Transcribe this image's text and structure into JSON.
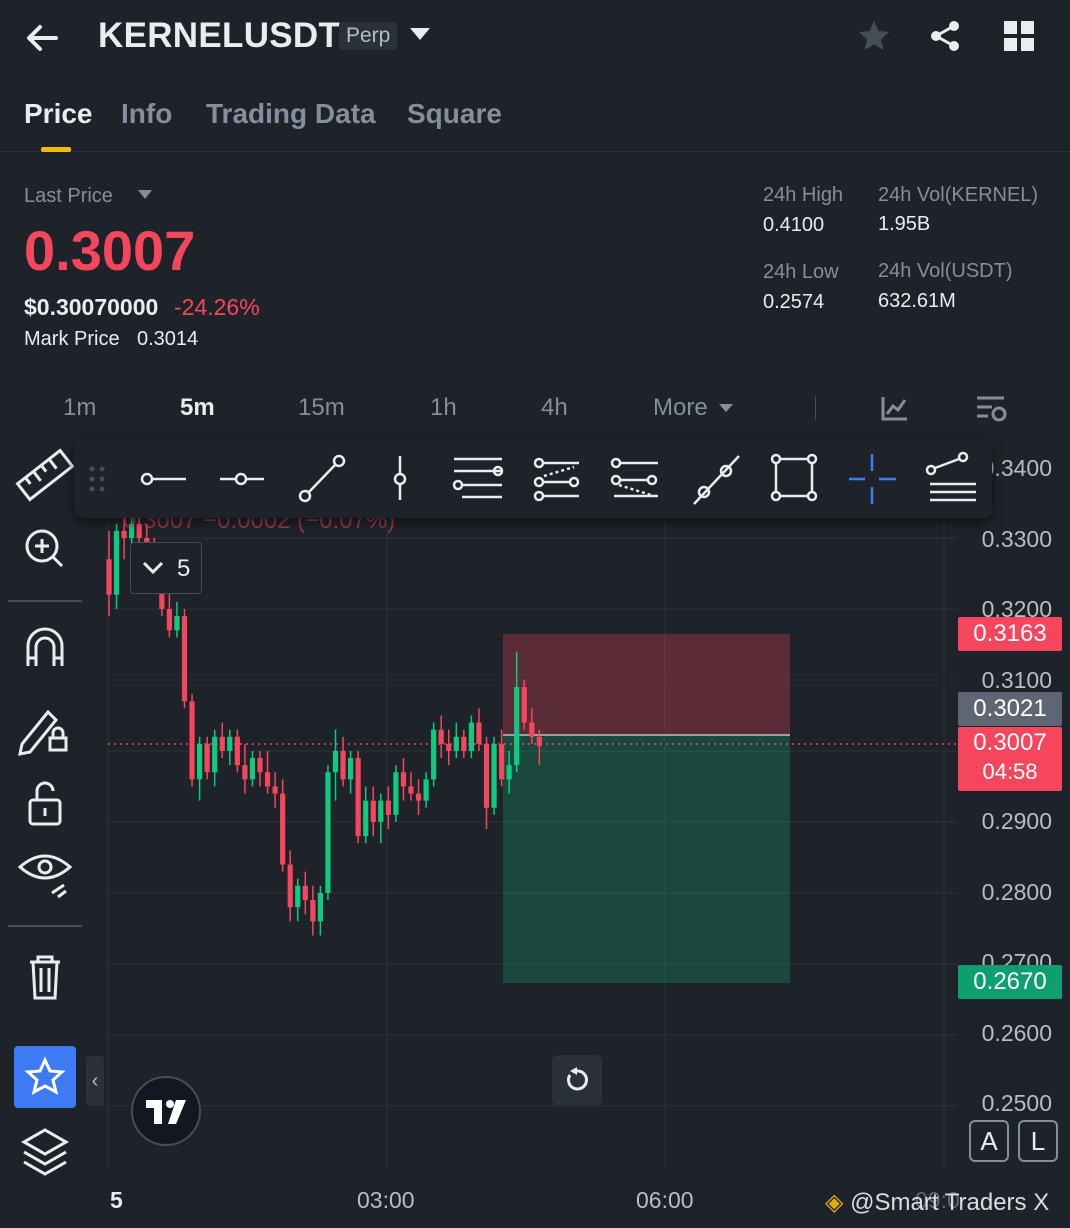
{
  "header": {
    "symbol": "KERNELUSDT",
    "badge": "Perp",
    "icons": [
      "back-arrow-icon",
      "star-icon",
      "share-icon",
      "grid-icon"
    ]
  },
  "tabs": [
    "Price",
    "Info",
    "Trading Data",
    "Square"
  ],
  "active_tab": "Price",
  "price_panel": {
    "last_price_label": "Last Price",
    "last_price": "0.3007",
    "usd_price": "$0.30070000",
    "change": "-24.26%",
    "mark_label": "Mark Price",
    "mark_value": "0.3014",
    "high_label": "24h High",
    "high_value": "0.4100",
    "low_label": "24h Low",
    "low_value": "0.2574",
    "vol_base_label": "24h Vol(KERNEL)",
    "vol_base_value": "1.95B",
    "vol_quote_label": "24h Vol(USDT)",
    "vol_quote_value": "632.61M"
  },
  "timeframes": [
    "1m",
    "5m",
    "15m",
    "1h",
    "4h",
    "More"
  ],
  "active_timeframe": "5m",
  "chart": {
    "legend_faded": "0.3007  −0.0002 (−0.07%)",
    "interval_badge": "5",
    "y_ticks": [
      "0.3400",
      "0.3300",
      "0.3200",
      "0.3100",
      "0.2900",
      "0.2800",
      "0.2700",
      "0.2600",
      "0.2500"
    ],
    "x_ticks": [
      "5",
      "03:00",
      "06:00",
      "09:0"
    ],
    "tags": {
      "stop": "0.3163",
      "mark": "0.3021",
      "last": "0.3007",
      "countdown": "04:58",
      "target": "0.2670"
    },
    "watermark": "@Smart Traders X",
    "scale_buttons": [
      "A",
      "L"
    ],
    "colors": {
      "up": "#0ecb81",
      "down": "#f6465d",
      "accent": "#f0b90b",
      "tool_active": "#3d7bf5"
    }
  },
  "chart_data": {
    "type": "candlestick",
    "interval": "5m",
    "ylim": [
      0.25,
      0.343
    ],
    "position": {
      "entry": 0.3021,
      "stop_loss": 0.3163,
      "take_profit": 0.267
    },
    "last_price": 0.3007,
    "candles": [
      [
        0.327,
        0.331,
        0.319,
        0.322
      ],
      [
        0.322,
        0.332,
        0.32,
        0.331
      ],
      [
        0.331,
        0.334,
        0.327,
        0.33
      ],
      [
        0.33,
        0.334,
        0.329,
        0.332
      ],
      [
        0.332,
        0.333,
        0.329,
        0.33
      ],
      [
        0.33,
        0.332,
        0.328,
        0.329
      ],
      [
        0.329,
        0.33,
        0.325,
        0.327
      ],
      [
        0.327,
        0.328,
        0.319,
        0.32
      ],
      [
        0.32,
        0.324,
        0.316,
        0.317
      ],
      [
        0.317,
        0.321,
        0.316,
        0.319
      ],
      [
        0.319,
        0.32,
        0.306,
        0.307
      ],
      [
        0.307,
        0.308,
        0.295,
        0.296
      ],
      [
        0.296,
        0.302,
        0.293,
        0.301
      ],
      [
        0.301,
        0.302,
        0.296,
        0.297
      ],
      [
        0.297,
        0.303,
        0.295,
        0.302
      ],
      [
        0.302,
        0.304,
        0.299,
        0.3
      ],
      [
        0.3,
        0.303,
        0.298,
        0.302
      ],
      [
        0.302,
        0.303,
        0.297,
        0.298
      ],
      [
        0.298,
        0.301,
        0.294,
        0.296
      ],
      [
        0.296,
        0.3,
        0.295,
        0.299
      ],
      [
        0.299,
        0.3,
        0.295,
        0.297
      ],
      [
        0.297,
        0.3,
        0.294,
        0.295
      ],
      [
        0.295,
        0.297,
        0.292,
        0.294
      ],
      [
        0.294,
        0.296,
        0.283,
        0.284
      ],
      [
        0.284,
        0.286,
        0.276,
        0.278
      ],
      [
        0.278,
        0.282,
        0.276,
        0.281
      ],
      [
        0.281,
        0.283,
        0.277,
        0.279
      ],
      [
        0.279,
        0.281,
        0.274,
        0.276
      ],
      [
        0.276,
        0.281,
        0.274,
        0.28
      ],
      [
        0.28,
        0.298,
        0.279,
        0.297
      ],
      [
        0.297,
        0.303,
        0.293,
        0.3
      ],
      [
        0.3,
        0.302,
        0.295,
        0.296
      ],
      [
        0.296,
        0.3,
        0.294,
        0.299
      ],
      [
        0.299,
        0.3,
        0.287,
        0.288
      ],
      [
        0.288,
        0.295,
        0.287,
        0.293
      ],
      [
        0.293,
        0.295,
        0.288,
        0.29
      ],
      [
        0.29,
        0.294,
        0.287,
        0.293
      ],
      [
        0.293,
        0.295,
        0.289,
        0.291
      ],
      [
        0.291,
        0.298,
        0.29,
        0.297
      ],
      [
        0.297,
        0.299,
        0.293,
        0.295
      ],
      [
        0.295,
        0.297,
        0.293,
        0.294
      ],
      [
        0.294,
        0.296,
        0.291,
        0.293
      ],
      [
        0.293,
        0.297,
        0.292,
        0.296
      ],
      [
        0.296,
        0.304,
        0.295,
        0.303
      ],
      [
        0.303,
        0.305,
        0.299,
        0.301
      ],
      [
        0.301,
        0.303,
        0.298,
        0.3
      ],
      [
        0.3,
        0.304,
        0.299,
        0.302
      ],
      [
        0.302,
        0.303,
        0.299,
        0.3
      ],
      [
        0.3,
        0.305,
        0.299,
        0.304
      ],
      [
        0.304,
        0.306,
        0.3,
        0.301
      ],
      [
        0.301,
        0.302,
        0.289,
        0.292
      ],
      [
        0.292,
        0.302,
        0.291,
        0.301
      ],
      [
        0.301,
        0.303,
        0.295,
        0.296
      ],
      [
        0.296,
        0.3,
        0.294,
        0.298
      ],
      [
        0.298,
        0.314,
        0.297,
        0.309
      ],
      [
        0.309,
        0.31,
        0.303,
        0.304
      ],
      [
        0.304,
        0.306,
        0.301,
        0.302
      ],
      [
        0.302,
        0.303,
        0.298,
        0.3007
      ]
    ]
  }
}
